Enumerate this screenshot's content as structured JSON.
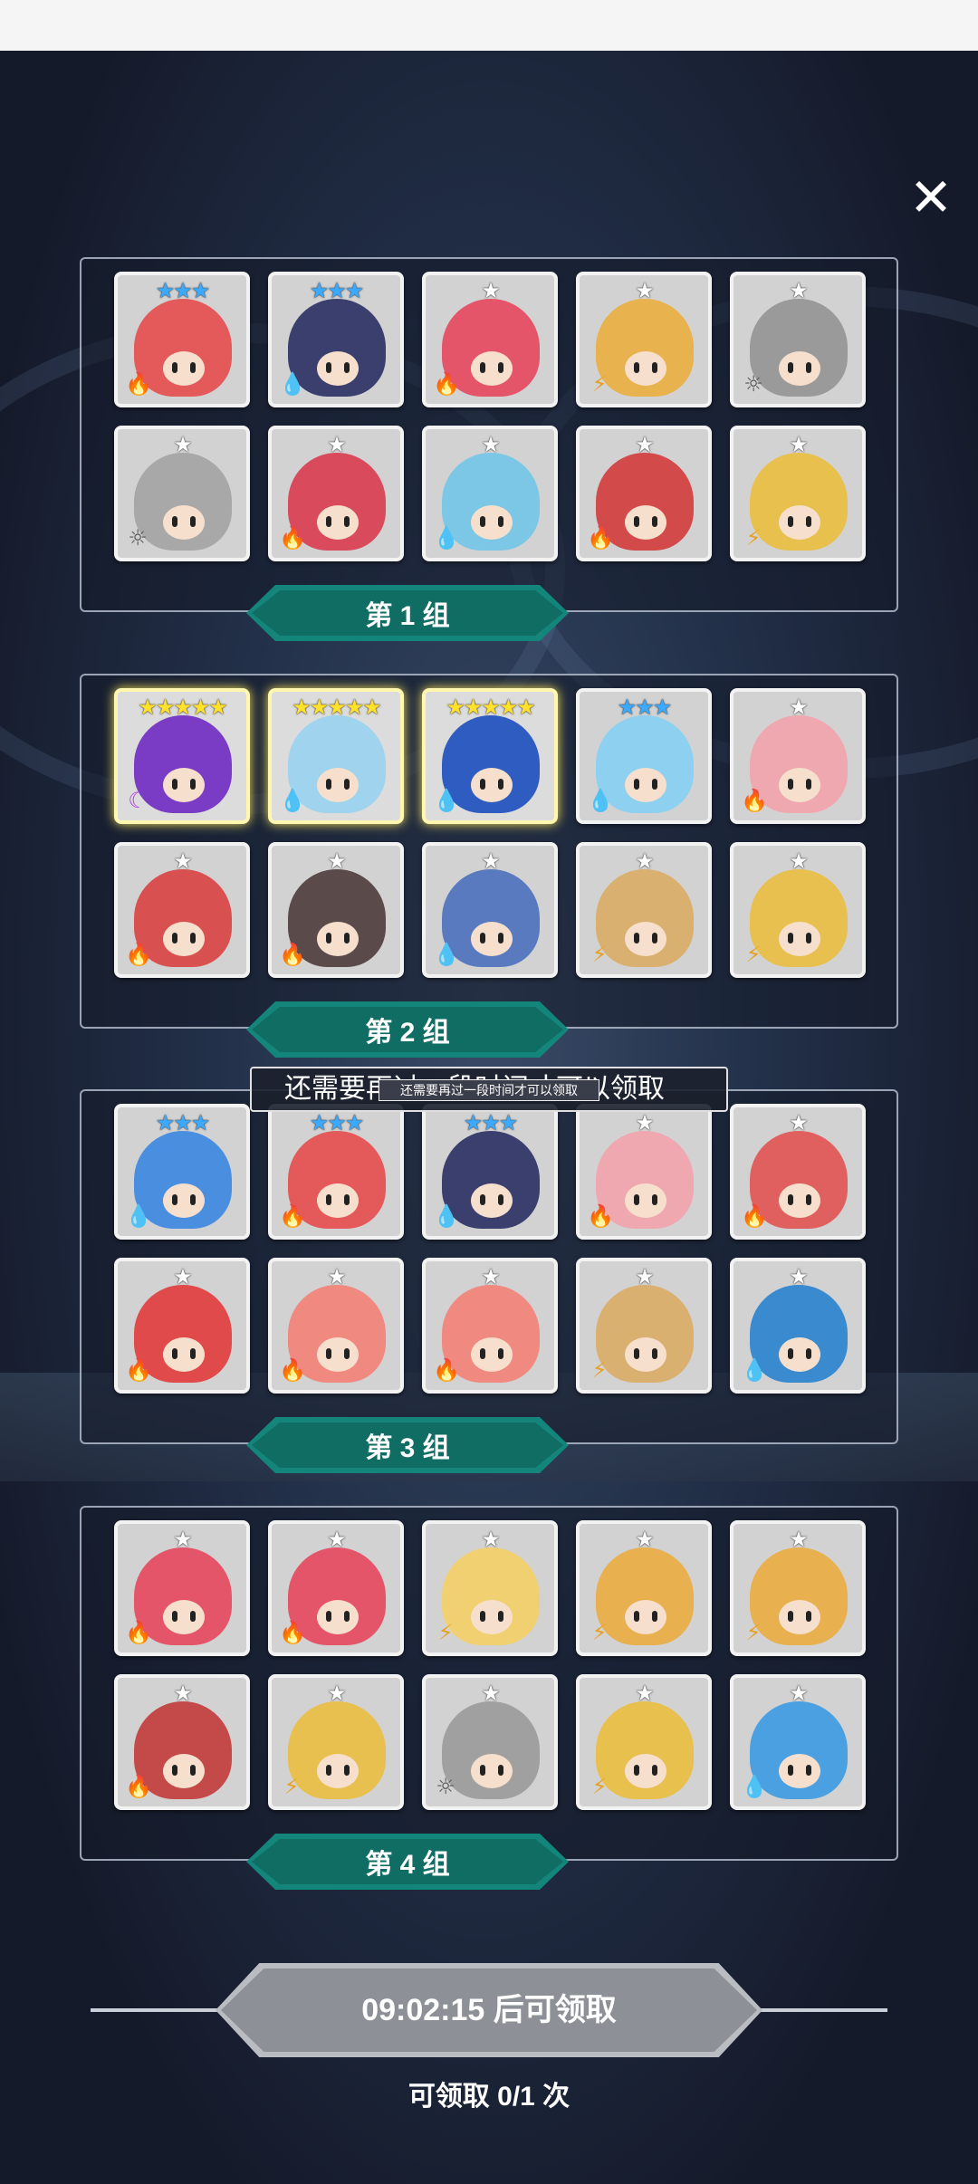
{
  "close_label": "✕",
  "toast": {
    "text": "还需要再过一段时间才可以领取",
    "small_text": "还需要再过一段时间才可以领取"
  },
  "groups": [
    {
      "label": "第 1 组",
      "cards": [
        {
          "stars": "★★★",
          "star_color": "#3aa9ff",
          "element": "fire",
          "bg": "#e45a5a"
        },
        {
          "stars": "★★★",
          "star_color": "#3aa9ff",
          "element": "water",
          "bg": "#3a3f6e"
        },
        {
          "stars": "★",
          "star_color": "#ffffff",
          "element": "fire",
          "bg": "#e4556a"
        },
        {
          "stars": "★",
          "star_color": "#ffffff",
          "element": "wind",
          "bg": "#e8b24e"
        },
        {
          "stars": "★",
          "star_color": "#ffffff",
          "element": "light",
          "bg": "#9a9a9a"
        },
        {
          "stars": "★",
          "star_color": "#ffffff",
          "element": "light",
          "bg": "#a8a8a8"
        },
        {
          "stars": "★",
          "star_color": "#ffffff",
          "element": "fire",
          "bg": "#d84a5c"
        },
        {
          "stars": "★",
          "star_color": "#ffffff",
          "element": "water",
          "bg": "#7cc7e6"
        },
        {
          "stars": "★",
          "star_color": "#ffffff",
          "element": "fire",
          "bg": "#d24a4a"
        },
        {
          "stars": "★",
          "star_color": "#ffffff",
          "element": "wind",
          "bg": "#e8c04e"
        }
      ]
    },
    {
      "label": "第 2 组",
      "cards": [
        {
          "stars": "★★★★★",
          "star_color": "#ffe02a",
          "element": "dark",
          "bg": "#7a3cc4",
          "gold": true
        },
        {
          "stars": "★★★★★",
          "star_color": "#ffe02a",
          "element": "water",
          "bg": "#9fd3ee",
          "gold": true
        },
        {
          "stars": "★★★★★",
          "star_color": "#ffe02a",
          "element": "water",
          "bg": "#2e5cc0",
          "gold": true
        },
        {
          "stars": "★★★",
          "star_color": "#3aa9ff",
          "element": "water",
          "bg": "#8ed0f0"
        },
        {
          "stars": "★",
          "star_color": "#ffffff",
          "element": "fire",
          "bg": "#f0a8b0"
        },
        {
          "stars": "★",
          "star_color": "#ffffff",
          "element": "fire",
          "bg": "#d85050"
        },
        {
          "stars": "★",
          "star_color": "#ffffff",
          "element": "fire",
          "bg": "#5a4a4a"
        },
        {
          "stars": "★",
          "star_color": "#ffffff",
          "element": "water",
          "bg": "#5a7ac0"
        },
        {
          "stars": "★",
          "star_color": "#ffffff",
          "element": "wind",
          "bg": "#d9b070"
        },
        {
          "stars": "★",
          "star_color": "#ffffff",
          "element": "wind",
          "bg": "#e8c050"
        }
      ]
    },
    {
      "label": "第 3 组",
      "cards": [
        {
          "stars": "★★★",
          "star_color": "#3aa9ff",
          "element": "water",
          "bg": "#4a8ee0"
        },
        {
          "stars": "★★★",
          "star_color": "#3aa9ff",
          "element": "fire",
          "bg": "#e45a5a"
        },
        {
          "stars": "★★★",
          "star_color": "#3aa9ff",
          "element": "water",
          "bg": "#3a3f6e"
        },
        {
          "stars": "★",
          "star_color": "#ffffff",
          "element": "fire",
          "bg": "#f0a8b0"
        },
        {
          "stars": "★",
          "star_color": "#ffffff",
          "element": "fire",
          "bg": "#e06060"
        },
        {
          "stars": "★",
          "star_color": "#ffffff",
          "element": "fire",
          "bg": "#e04a4a"
        },
        {
          "stars": "★",
          "star_color": "#ffffff",
          "element": "fire",
          "bg": "#f08a80"
        },
        {
          "stars": "★",
          "star_color": "#ffffff",
          "element": "fire",
          "bg": "#f08a80"
        },
        {
          "stars": "★",
          "star_color": "#ffffff",
          "element": "wind",
          "bg": "#d9b070"
        },
        {
          "stars": "★",
          "star_color": "#ffffff",
          "element": "water",
          "bg": "#3a8ad0"
        }
      ]
    },
    {
      "label": "第 4 组",
      "cards": [
        {
          "stars": "★",
          "star_color": "#ffffff",
          "element": "fire",
          "bg": "#e4556a"
        },
        {
          "stars": "★",
          "star_color": "#ffffff",
          "element": "fire",
          "bg": "#e4556a"
        },
        {
          "stars": "★",
          "star_color": "#ffffff",
          "element": "wind",
          "bg": "#f0d070"
        },
        {
          "stars": "★",
          "star_color": "#ffffff",
          "element": "wind",
          "bg": "#e8b04e"
        },
        {
          "stars": "★",
          "star_color": "#ffffff",
          "element": "wind",
          "bg": "#e8b04e"
        },
        {
          "stars": "★",
          "star_color": "#ffffff",
          "element": "fire",
          "bg": "#c44a4a"
        },
        {
          "stars": "★",
          "star_color": "#ffffff",
          "element": "wind",
          "bg": "#e8c050"
        },
        {
          "stars": "★",
          "star_color": "#ffffff",
          "element": "light",
          "bg": "#a0a0a0"
        },
        {
          "stars": "★",
          "star_color": "#ffffff",
          "element": "wind",
          "bg": "#e8c04e"
        },
        {
          "stars": "★",
          "star_color": "#ffffff",
          "element": "water",
          "bg": "#4aa0e0"
        }
      ]
    }
  ],
  "element_icons": {
    "fire": "🔥",
    "water": "💧",
    "wind": "⚡",
    "light": "☼",
    "dark": "☾"
  },
  "element_colors": {
    "fire": "#e83a2a",
    "water": "#2a8ee8",
    "wind": "#e8a020",
    "light": "#555555",
    "dark": "#b040e0"
  },
  "claim": {
    "button_label": "09:02:15 后可领取",
    "count_text": "可领取 0/1 次"
  }
}
